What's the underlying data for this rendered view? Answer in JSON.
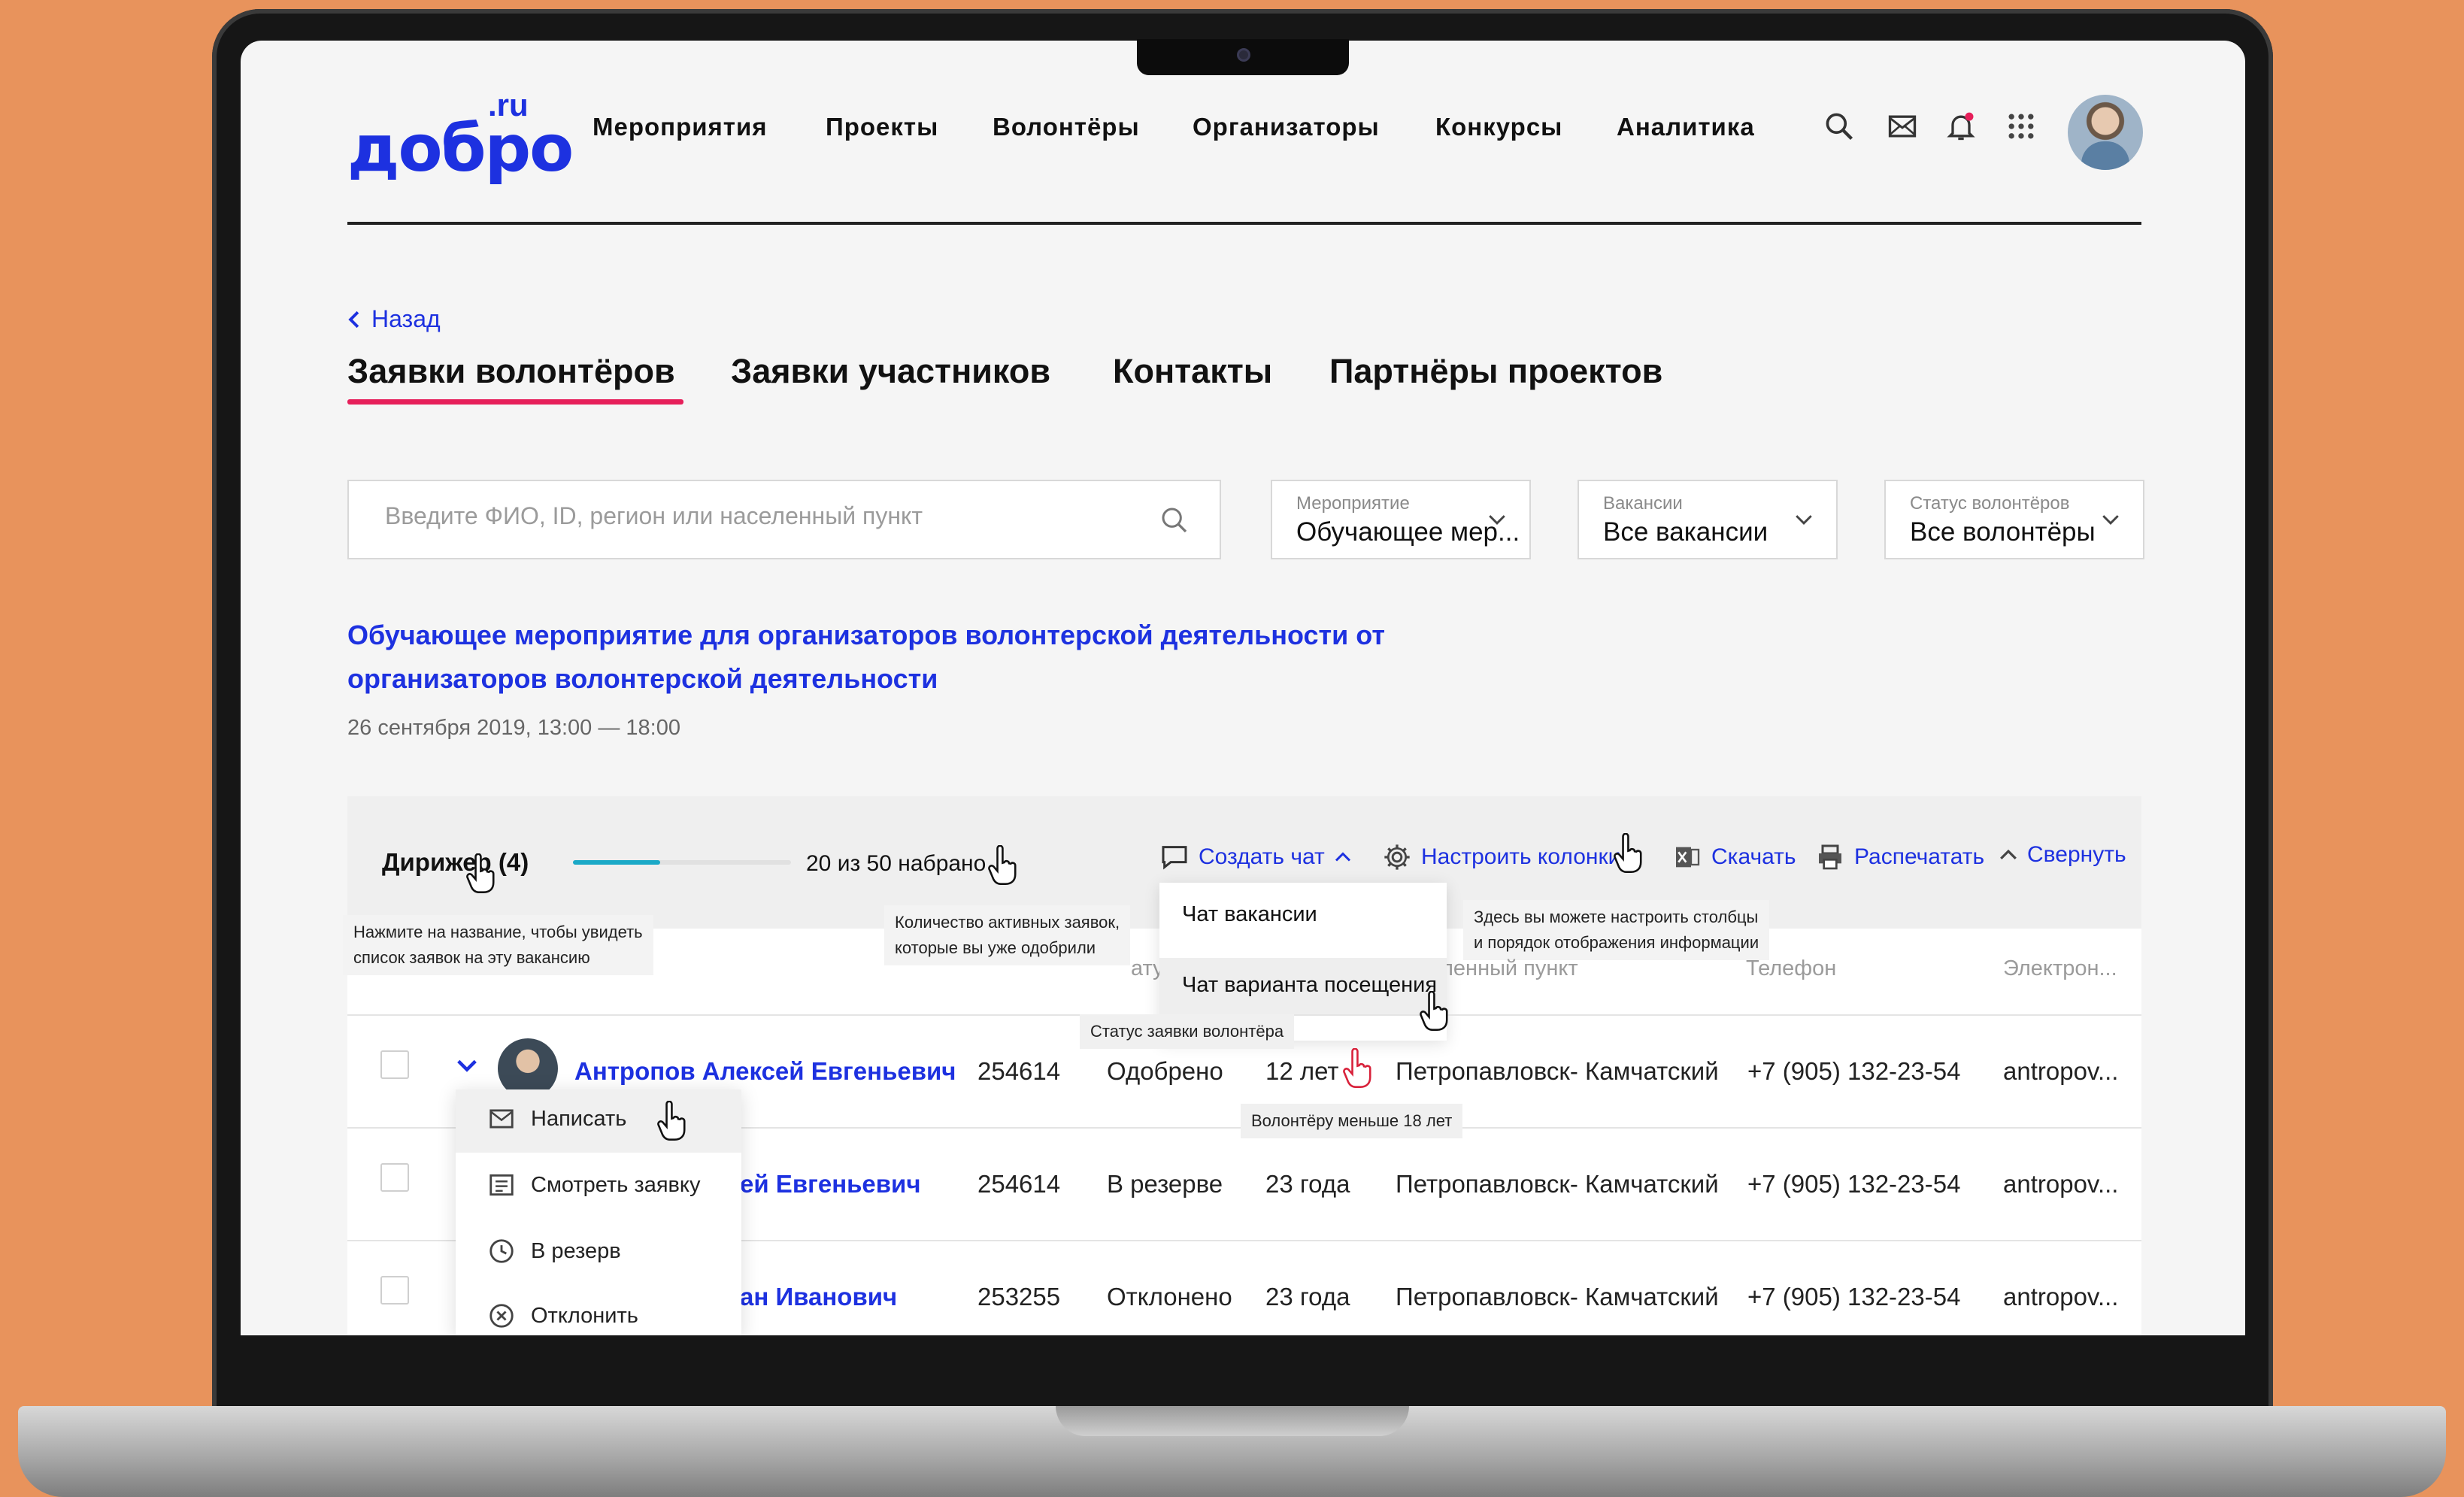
{
  "colors": {
    "brand": "#1D31E0",
    "tab_underline": "#E61F5A",
    "progress": "#1BA9C7",
    "background": "#E8935C"
  },
  "header": {
    "logo_main": "добро",
    "logo_suffix": ".ru",
    "nav": [
      "Мероприятия",
      "Проекты",
      "Волонтёры",
      "Организаторы",
      "Конкурсы",
      "Аналитика"
    ],
    "icons": [
      "search-icon",
      "mail-icon",
      "bell-icon",
      "apps-grid-icon",
      "avatar"
    ]
  },
  "back": {
    "label": "Назад"
  },
  "tabs": [
    {
      "label": "Заявки волонтёров",
      "active": true
    },
    {
      "label": "Заявки участников",
      "active": false
    },
    {
      "label": "Контакты",
      "active": false
    },
    {
      "label": "Партнёры проектов",
      "active": false
    }
  ],
  "filters": {
    "search_placeholder": "Введите ФИО, ID, регион или населенный пункт",
    "event": {
      "label": "Мероприятие",
      "value": "Обучающее мер..."
    },
    "vacancy": {
      "label": "Вакансии",
      "value": "Все вакансии"
    },
    "status": {
      "label": "Статус волонтёров",
      "value": "Все волонтёры"
    }
  },
  "event": {
    "title": "Обучающее мероприятие для организаторов волонтерской деятельности от организаторов волонтерской деятельности",
    "date": "26 сентября 2019, 13:00 — 18:00"
  },
  "vacancy": {
    "name": "Дирижер (4)",
    "progress_text": "20 из 50 набрано",
    "progress_fraction": 0.4
  },
  "toolbar": {
    "create_chat": "Создать чат",
    "configure_columns": "Настроить колонки",
    "download": "Скачать",
    "print": "Распечатать",
    "collapse": "Свернуть"
  },
  "chat_menu": [
    "Чат вакансии",
    "Чат варианта посещения"
  ],
  "tooltips": {
    "name_hint": [
      "Нажмите на название, чтобы увидеть",
      "список заявок на эту вакансию"
    ],
    "count_hint": [
      "Количество активных заявок,",
      "которые вы уже одобрили"
    ],
    "columns_hint": [
      "Здесь вы можете настроить столбцы",
      "и порядок отображения информации"
    ],
    "status_hint": "Статус заявки волонтёра",
    "age_hint": "Волонтёру меньше 18 лет"
  },
  "table": {
    "visible_headers": [
      "ату",
      "ленный пункт",
      "Телефон",
      "Электрон..."
    ],
    "rows": [
      {
        "name": "Антропов Алексей Евгеньевич",
        "id": "254614",
        "status": "Одобрено",
        "age": "12 лет",
        "city": "Петропавловск- Камчатский",
        "phone": "+7 (905) 132-23-54",
        "email": "antropov..."
      },
      {
        "name": "ей Евгеньевич",
        "id": "254614",
        "status": "В резерве",
        "age": "23 года",
        "city": "Петропавловск- Камчатский",
        "phone": "+7 (905) 132-23-54",
        "email": "antropov..."
      },
      {
        "name": "ан Иванович",
        "id": "253255",
        "status": "Отклонено",
        "age": "23 года",
        "city": "Петропавловск- Камчатский",
        "phone": "+7 (905) 132-23-54",
        "email": "antropov..."
      }
    ]
  },
  "context_menu": [
    "Написать",
    "Смотреть заявку",
    "В резерв",
    "Отклонить"
  ]
}
